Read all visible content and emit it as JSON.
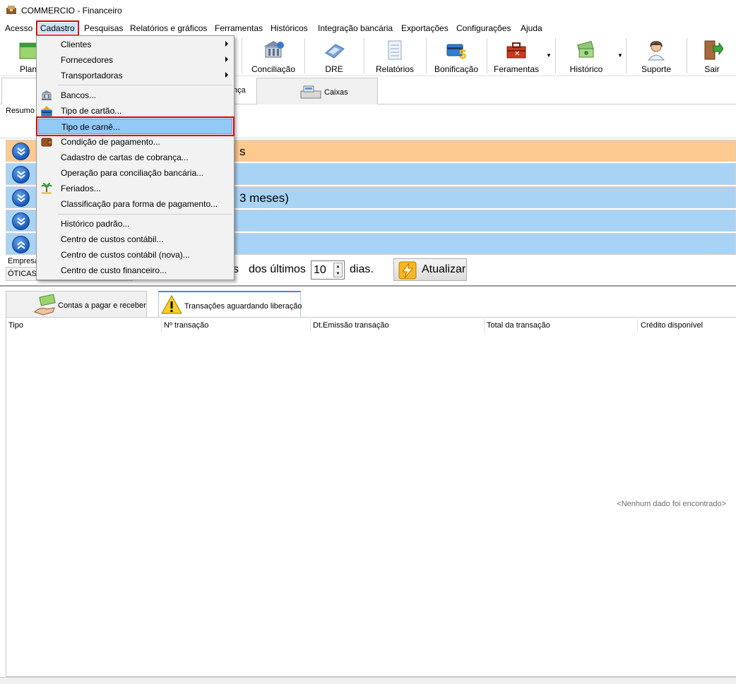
{
  "window": {
    "title": "COMMERCIO - Financeiro"
  },
  "menubar": {
    "items": [
      "Acesso",
      "Cadastro",
      "Pesquisas",
      "Relatórios e gráficos",
      "Ferramentas",
      "Históricos",
      "Integração bancária",
      "Exportações",
      "Configurações",
      "Ajuda"
    ],
    "active": "Cadastro"
  },
  "toolbar": {
    "buttons": [
      "Plan",
      "Conciliação",
      "DRE",
      "Relatórios",
      "Bonificação",
      "Feramentas",
      "Histórico",
      "Suporte",
      "Sair"
    ]
  },
  "top_tabs": {
    "partial_label": "nça",
    "caixas": "Caixas"
  },
  "resumo_label": "Resumo",
  "accordion": {
    "row1_text": "s",
    "row3_text": "3 meses)"
  },
  "filter": {
    "empresa_label": "Empresa",
    "empresa_value": "ÓTICAS",
    "partial_text": "s",
    "dos_ultimos": "dos últimos",
    "days_value": "10",
    "dias_label": "dias.",
    "refresh_button": "Atualizar"
  },
  "bottom_tabs": {
    "tab1": "Contas a pagar e receber",
    "tab2": "Transações aguardando liberação"
  },
  "grid": {
    "columns": [
      "Tipo",
      "Nº transação",
      "Dt.Emissão transação",
      "Total da transação",
      "Crédito disponível"
    ],
    "empty_text": "<Nenhum dado foi encontrado>"
  },
  "dropdown": {
    "items": [
      {
        "label": "Clientes",
        "submenu": true,
        "icon": ""
      },
      {
        "label": "Fornecedores",
        "submenu": true,
        "icon": ""
      },
      {
        "label": "Transportadoras",
        "submenu": true,
        "icon": ""
      },
      {
        "label": "Bancos...",
        "submenu": false,
        "icon": "bank-icon"
      },
      {
        "label": "Tipo de cartão...",
        "submenu": false,
        "icon": "card-icon"
      },
      {
        "label": "Tipo de carnê...",
        "submenu": false,
        "icon": "",
        "highlighted": true
      },
      {
        "label": "Condição de pagamento...",
        "submenu": false,
        "icon": "wallet-icon"
      },
      {
        "label": "Cadastro de cartas de cobrança...",
        "submenu": false,
        "icon": ""
      },
      {
        "label": "Operação para conciliação bancária...",
        "submenu": false,
        "icon": ""
      },
      {
        "label": "Feriados...",
        "submenu": false,
        "icon": "palm-tree-icon"
      },
      {
        "label": "Classificação para forma de pagamento...",
        "submenu": false,
        "icon": ""
      },
      {
        "label": "Histórico padrão...",
        "submenu": false,
        "icon": ""
      },
      {
        "label": "Centro de custos contábil...",
        "submenu": false,
        "icon": ""
      },
      {
        "label": "Centro de custos contábil (nova)...",
        "submenu": false,
        "icon": ""
      },
      {
        "label": "Centro de custo financeiro...",
        "submenu": false,
        "icon": ""
      }
    ]
  },
  "colors": {
    "accordion_orange": "#fcc98f",
    "accordion_blue": "#a9d3f5",
    "highlight_red": "#e00000",
    "menu_highlight": "#91c9f7"
  }
}
